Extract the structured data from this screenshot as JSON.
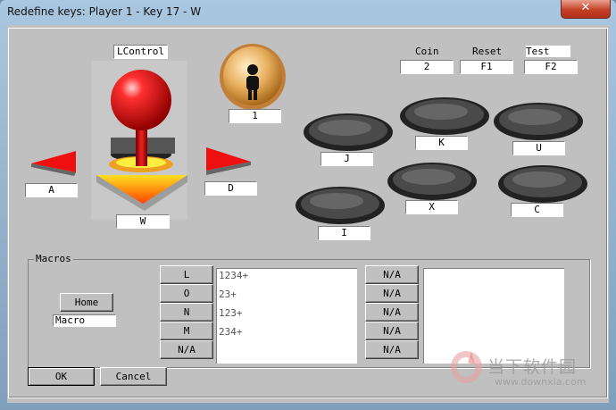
{
  "window": {
    "title": "Redefine keys: Player 1 - Key 17 - W"
  },
  "joystick": {
    "label": "LControl",
    "left": "A",
    "right": "D",
    "down": "W"
  },
  "coin_button": {
    "label": "1"
  },
  "top_keys": [
    {
      "caption": "Coin",
      "value": "2"
    },
    {
      "caption": "Reset",
      "value": "F1"
    },
    {
      "caption": "Test",
      "value": "F2"
    }
  ],
  "arcade_buttons": [
    "J",
    "K",
    "U",
    "I",
    "X",
    "C"
  ],
  "macros": {
    "title": "Macros",
    "home_button": "Home",
    "macro_field": "Macro",
    "keys": [
      "L",
      "O",
      "N",
      "M",
      "N/A"
    ],
    "lines": [
      "1234+",
      "23+",
      "123+",
      "234+"
    ],
    "right_keys": [
      "N/A",
      "N/A",
      "N/A",
      "N/A",
      "N/A"
    ]
  },
  "footer": {
    "ok": "OK",
    "cancel": "Cancel"
  },
  "watermark": {
    "brand": "当下软件园",
    "url": "www.downxia.com"
  }
}
